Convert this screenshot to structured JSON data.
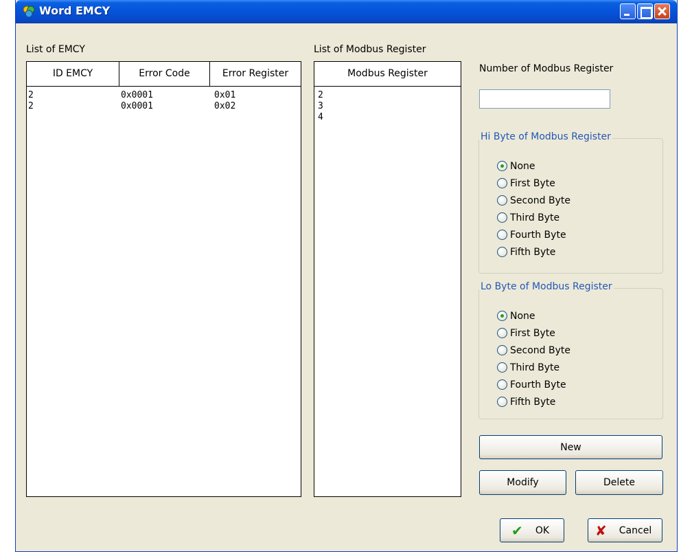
{
  "window": {
    "title": "Word EMCY"
  },
  "emcy_list": {
    "label": "List of EMCY",
    "columns": [
      "ID EMCY",
      "Error Code",
      "Error Register"
    ],
    "rows": [
      [
        "2",
        "0x0001",
        "0x01"
      ],
      [
        "2",
        "0x0001",
        "0x02"
      ]
    ]
  },
  "modbus_list": {
    "label": "List of Modbus Register",
    "column": "Modbus Register",
    "rows": [
      "2",
      "3",
      "4"
    ]
  },
  "number_field": {
    "label": "Number of Modbus Register",
    "value": ""
  },
  "hi_byte": {
    "title": "Hi Byte of Modbus Register",
    "options": [
      "None",
      "First Byte",
      "Second Byte",
      "Third Byte",
      "Fourth Byte",
      "Fifth Byte"
    ],
    "selected": "None"
  },
  "lo_byte": {
    "title": "Lo Byte of Modbus Register",
    "options": [
      "None",
      "First Byte",
      "Second Byte",
      "Third Byte",
      "Fourth Byte",
      "Fifth Byte"
    ],
    "selected": "None"
  },
  "buttons": {
    "new": "New",
    "modify": "Modify",
    "delete": "Delete",
    "ok": "OK",
    "cancel": "Cancel"
  },
  "colors": {
    "title_bar": "#0553d9",
    "group_title": "#2457b5",
    "ok_check": "#1f9b1f",
    "cancel_x": "#c01010"
  }
}
